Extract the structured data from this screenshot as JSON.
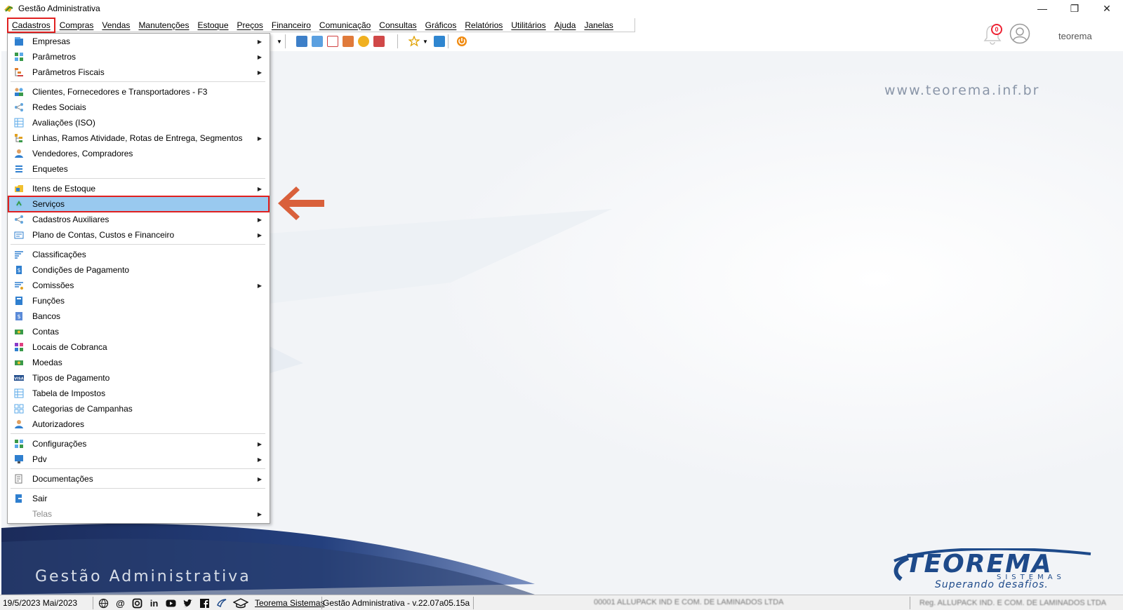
{
  "window": {
    "title": "Gestão Administrativa",
    "controls": [
      "—",
      "❐",
      "✕"
    ]
  },
  "menubar": {
    "items": [
      "Cadastros",
      "Compras",
      "Vendas",
      "Manutenções",
      "Estoque",
      "Preços",
      "Financeiro",
      "Comunicação",
      "Consultas",
      "Gráficos",
      "Relatórios",
      "Utilitários",
      "Ajuda",
      "Janelas"
    ],
    "active": "Cadastros"
  },
  "header": {
    "notifications_count": "0",
    "user_name": "teorema"
  },
  "background": {
    "website": "www.teorema.inf.br",
    "app_brand": "Gestão Administrativa",
    "logo_name": "TEOREMA",
    "logo_sub": "SISTEMAS",
    "logo_slogan": "Superando desafios."
  },
  "cadastros_menu": {
    "items": [
      {
        "label": "Empresas",
        "submenu": true,
        "icon": "building-icon"
      },
      {
        "label": "Parâmetros",
        "submenu": true,
        "icon": "grid-icon"
      },
      {
        "label": "Parâmetros Fiscais",
        "submenu": true,
        "icon": "tree-icon"
      },
      {
        "label": "Clientes, Fornecedores e Transportadores - F3",
        "submenu": false,
        "icon": "people-icon"
      },
      {
        "label": "Redes Sociais",
        "submenu": false,
        "icon": "share-icon"
      },
      {
        "label": "Avaliações (ISO)",
        "submenu": false,
        "icon": "table-icon"
      },
      {
        "label": "Linhas, Ramos Atividade, Rotas de Entrega, Segmentos",
        "submenu": true,
        "icon": "branch-icon"
      },
      {
        "label": "Vendedores, Compradores",
        "submenu": false,
        "icon": "person-icon"
      },
      {
        "label": "Enquetes",
        "submenu": false,
        "icon": "list-icon"
      },
      {
        "label": "Itens de Estoque",
        "submenu": true,
        "icon": "folder-icon"
      },
      {
        "label": "Serviços",
        "submenu": false,
        "icon": "service-icon"
      },
      {
        "label": "Cadastros Auxiliares",
        "submenu": true,
        "icon": "share-icon"
      },
      {
        "label": "Plano de Contas, Custos e Financeiro",
        "submenu": true,
        "icon": "card-icon"
      },
      {
        "label": "Classificações",
        "submenu": false,
        "icon": "lines-icon"
      },
      {
        "label": "Condições de Pagamento",
        "submenu": false,
        "icon": "dollar-doc-icon"
      },
      {
        "label": "Comissões",
        "submenu": true,
        "icon": "lines-icon"
      },
      {
        "label": "Funções",
        "submenu": false,
        "icon": "book-icon"
      },
      {
        "label": "Bancos",
        "submenu": false,
        "icon": "bank-icon"
      },
      {
        "label": "Contas",
        "submenu": false,
        "icon": "money-icon"
      },
      {
        "label": "Locais de Cobranca",
        "submenu": false,
        "icon": "blocks-icon"
      },
      {
        "label": "Moedas",
        "submenu": false,
        "icon": "money-icon"
      },
      {
        "label": "Tipos de Pagamento",
        "submenu": false,
        "icon": "visa-icon"
      },
      {
        "label": "Tabela de Impostos",
        "submenu": false,
        "icon": "table-icon"
      },
      {
        "label": "Categorias de Campanhas",
        "submenu": false,
        "icon": "grid-icon"
      },
      {
        "label": "Autorizadores",
        "submenu": false,
        "icon": "person-icon"
      },
      {
        "label": "Configurações",
        "submenu": true,
        "icon": "grid-icon"
      },
      {
        "label": "Pdv",
        "submenu": true,
        "icon": "monitor-icon"
      },
      {
        "label": "Documentações",
        "submenu": true,
        "icon": "doc-icon"
      },
      {
        "label": "Sair",
        "submenu": false,
        "icon": "exit-icon"
      },
      {
        "label": "Telas",
        "submenu": true,
        "icon": "",
        "disabled": true
      }
    ],
    "highlighted": "Serviços"
  },
  "statusbar": {
    "date": "19/5/2023 Mai/2023",
    "link": "Teorema Sistemas",
    "version": "Gestão Administrativa - v.22.07a05.15a",
    "company": "00001 ALLUPACK IND E COM. DE LAMINADOS LTDA",
    "registered": "Reg. ALLUPACK IND. E COM. DE LAMINADOS LTDA",
    "social_icons": [
      "globe-icon",
      "at-icon",
      "instagram-icon",
      "linkedin-icon",
      "youtube-icon",
      "twitter-icon",
      "facebook-icon",
      "teorema-bird-icon",
      "teorema-logo-icon"
    ]
  },
  "colors": {
    "highlight": "#99c9ef",
    "annotation": "#e02020",
    "arrow": "#d9603b",
    "brand": "#1e4a8a"
  }
}
